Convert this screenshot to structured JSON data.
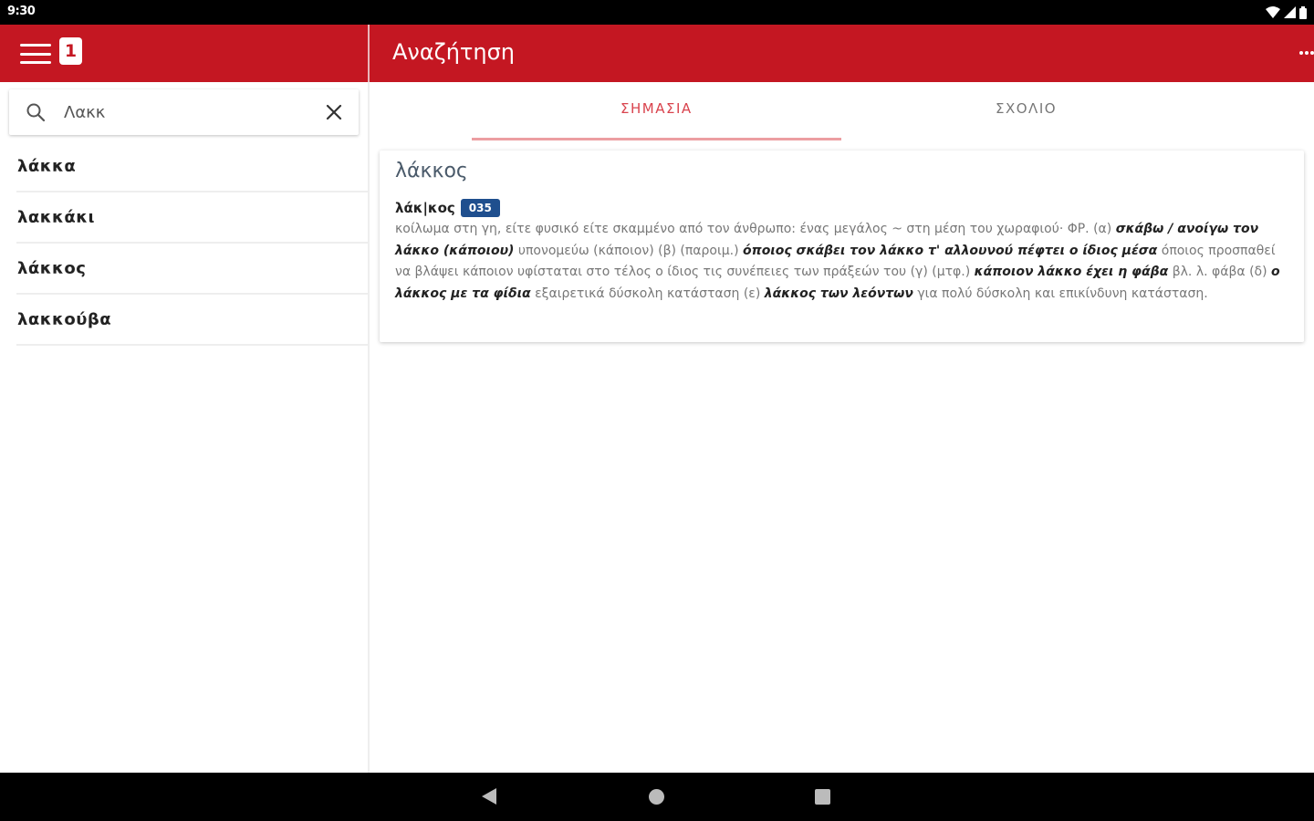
{
  "status_bar": {
    "time": "9:30"
  },
  "left_header": {
    "badge": "1"
  },
  "header": {
    "title": "Αναζήτηση"
  },
  "search": {
    "value": "Λακκ"
  },
  "results": [
    "λάκκα",
    "λακκάκι",
    "λάκκος",
    "λακκούβα"
  ],
  "tabs": [
    {
      "label": "ΣΗΜΑΣΙΑ",
      "active": true
    },
    {
      "label": "ΣΧΟΛΙΟ",
      "active": false
    }
  ],
  "entry": {
    "title": "λάκκος",
    "headword": "λάκ|κος",
    "code": "035",
    "definition": [
      {
        "t": "κοίλωμα στη γη, είτε φυσικό είτε σκαμμένο από τον άνθρωπο: ένας μεγάλος ~ στη μέση του χωραφιού· ΦΡ. (α) ",
        "b": false
      },
      {
        "t": "σκάβω / ανοίγω τον λάκκο (κάποιου)",
        "b": true
      },
      {
        "t": " υπονομεύω (κάποιον) (β) (παροιμ.) ",
        "b": false
      },
      {
        "t": "όποιος σκάβει τον λάκκο τ' αλλουνού πέφτει ο ίδιος μέσα",
        "b": true
      },
      {
        "t": " όποιος προσπαθεί να βλάψει κάποιον υφίσταται στο τέλος ο ίδιος τις συνέπειες των πράξεών του (γ) (μτφ.) ",
        "b": false
      },
      {
        "t": "κάποιον λάκκο έχει η φάβα",
        "b": true
      },
      {
        "t": " βλ. λ. φάβα (δ) ",
        "b": false
      },
      {
        "t": "ο λάκκος με τα φίδια",
        "b": true
      },
      {
        "t": " εξαιρετικά δύσκολη κατάσταση (ε) ",
        "b": false
      },
      {
        "t": "λάκκος των λεόντων",
        "b": true
      },
      {
        "t": " για πολύ δύσκολη και επικίνδυνη κατάσταση.",
        "b": false
      }
    ]
  },
  "colors": {
    "primary": "#c41722",
    "accent_tab": "#d9434d",
    "code_badge": "#1f4f8e"
  },
  "icons": [
    "menu-icon",
    "search-icon",
    "close-icon",
    "overflow-icon",
    "wifi-icon",
    "signal-icon",
    "battery-icon",
    "back-icon",
    "home-icon",
    "recents-icon"
  ]
}
